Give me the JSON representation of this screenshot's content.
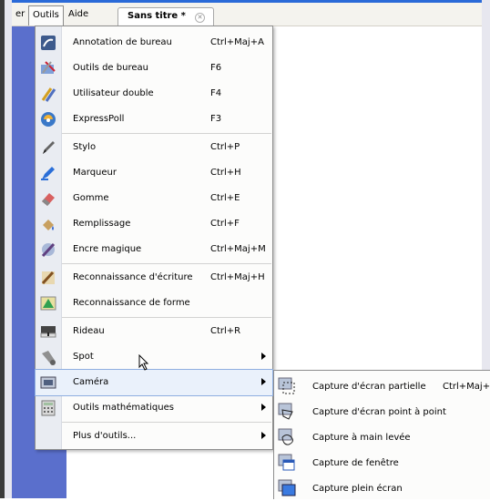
{
  "menubar": {
    "partial_item": "er",
    "items": [
      "Outils",
      "Aide"
    ],
    "doc_tab": "Sans titre *"
  },
  "menu": {
    "items": [
      {
        "label": "Annotation de bureau",
        "shortcut": "Ctrl+Maj+A",
        "icon": "desktop-annotation-icon"
      },
      {
        "label": "Outils de bureau",
        "shortcut": "F6",
        "icon": "desktop-tools-icon"
      },
      {
        "label": "Utilisateur double",
        "shortcut": "F4",
        "icon": "dual-user-icon"
      },
      {
        "label": "ExpressPoll",
        "shortcut": "F3",
        "icon": "expresspoll-icon"
      },
      {
        "label": "Stylo",
        "shortcut": "Ctrl+P",
        "icon": "pen-icon"
      },
      {
        "label": "Marqueur",
        "shortcut": "Ctrl+H",
        "icon": "highlighter-icon"
      },
      {
        "label": "Gomme",
        "shortcut": "Ctrl+E",
        "icon": "eraser-icon"
      },
      {
        "label": "Remplissage",
        "shortcut": "Ctrl+F",
        "icon": "fill-icon"
      },
      {
        "label": "Encre magique",
        "shortcut": "Ctrl+Maj+M",
        "icon": "magic-ink-icon"
      },
      {
        "label": "Reconnaissance d'écriture",
        "shortcut": "Ctrl+Maj+H",
        "icon": "handwriting-recognition-icon"
      },
      {
        "label": "Reconnaissance de forme",
        "shortcut": "",
        "icon": "shape-recognition-icon"
      },
      {
        "label": "Rideau",
        "shortcut": "Ctrl+R",
        "icon": "curtain-icon"
      },
      {
        "label": "Spot",
        "shortcut": "",
        "icon": "spotlight-icon"
      },
      {
        "label": "Caméra",
        "shortcut": "",
        "icon": "camera-icon"
      },
      {
        "label": "Outils mathématiques",
        "shortcut": "",
        "icon": "calculator-icon"
      },
      {
        "label": "Plus d'outils...",
        "shortcut": "",
        "icon": ""
      }
    ]
  },
  "submenu": {
    "items": [
      {
        "label": "Capture d'écran partielle",
        "shortcut": "Ctrl+Maj+",
        "icon": "partial-capture-icon"
      },
      {
        "label": "Capture d'écran point à point",
        "shortcut": "",
        "icon": "point-capture-icon"
      },
      {
        "label": "Capture à main levée",
        "shortcut": "",
        "icon": "freehand-capture-icon"
      },
      {
        "label": "Capture de fenêtre",
        "shortcut": "",
        "icon": "window-capture-icon"
      },
      {
        "label": "Capture plein écran",
        "shortcut": "",
        "icon": "fullscreen-capture-icon"
      }
    ]
  }
}
